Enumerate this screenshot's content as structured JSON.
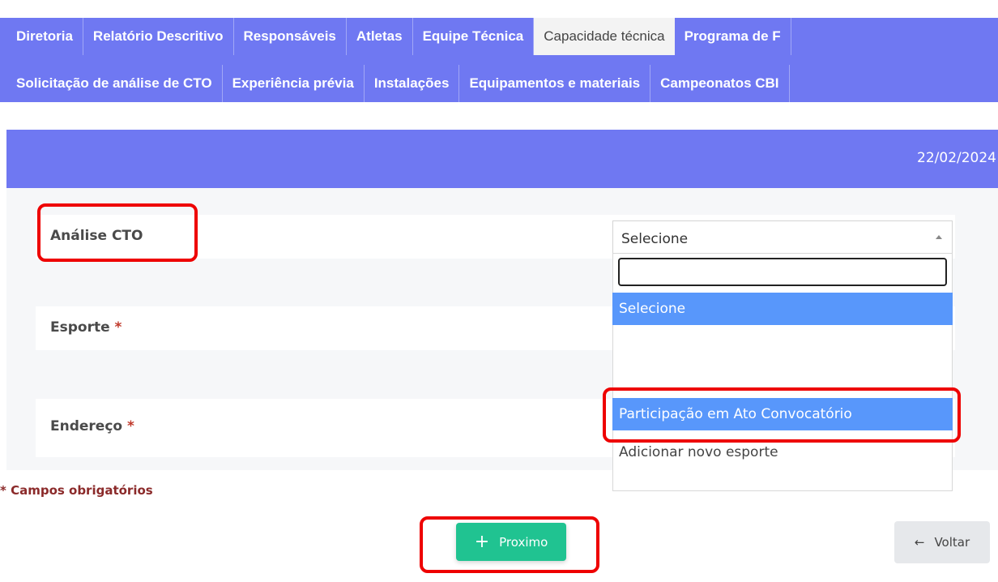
{
  "tabs_row1": [
    "Diretoria",
    "Relatório Descritivo",
    "Responsáveis",
    "Atletas",
    "Equipe Técnica",
    "Capacidade técnica",
    "Programa de F"
  ],
  "tabs_row2": [
    "Solicitação de análise de CTO",
    "Experiência prévia",
    "Instalações",
    "Equipamentos e materiais",
    "Campeonatos CBI"
  ],
  "active_tab": "Capacidade técnica",
  "header": {
    "date": "22/02/2024"
  },
  "form": {
    "analise_label": "Análise CTO",
    "esporte_label": "Esporte",
    "endereco_label": "Endereço",
    "required_mark": "*",
    "select_value": "Selecione",
    "search_value": "",
    "options": {
      "selected": "Selecione",
      "highlighted": "Participação em Ato Convocatório",
      "other": "Adicionar novo esporte"
    },
    "required_note": "* Campos obrigatórios"
  },
  "buttons": {
    "next": "Proximo",
    "next_icon": "+",
    "back": "Voltar",
    "back_icon": "←"
  },
  "colors": {
    "accent": "#6f78f2",
    "success": "#20c391",
    "highlight": "#5897fb",
    "annotation": "#ee0000"
  }
}
